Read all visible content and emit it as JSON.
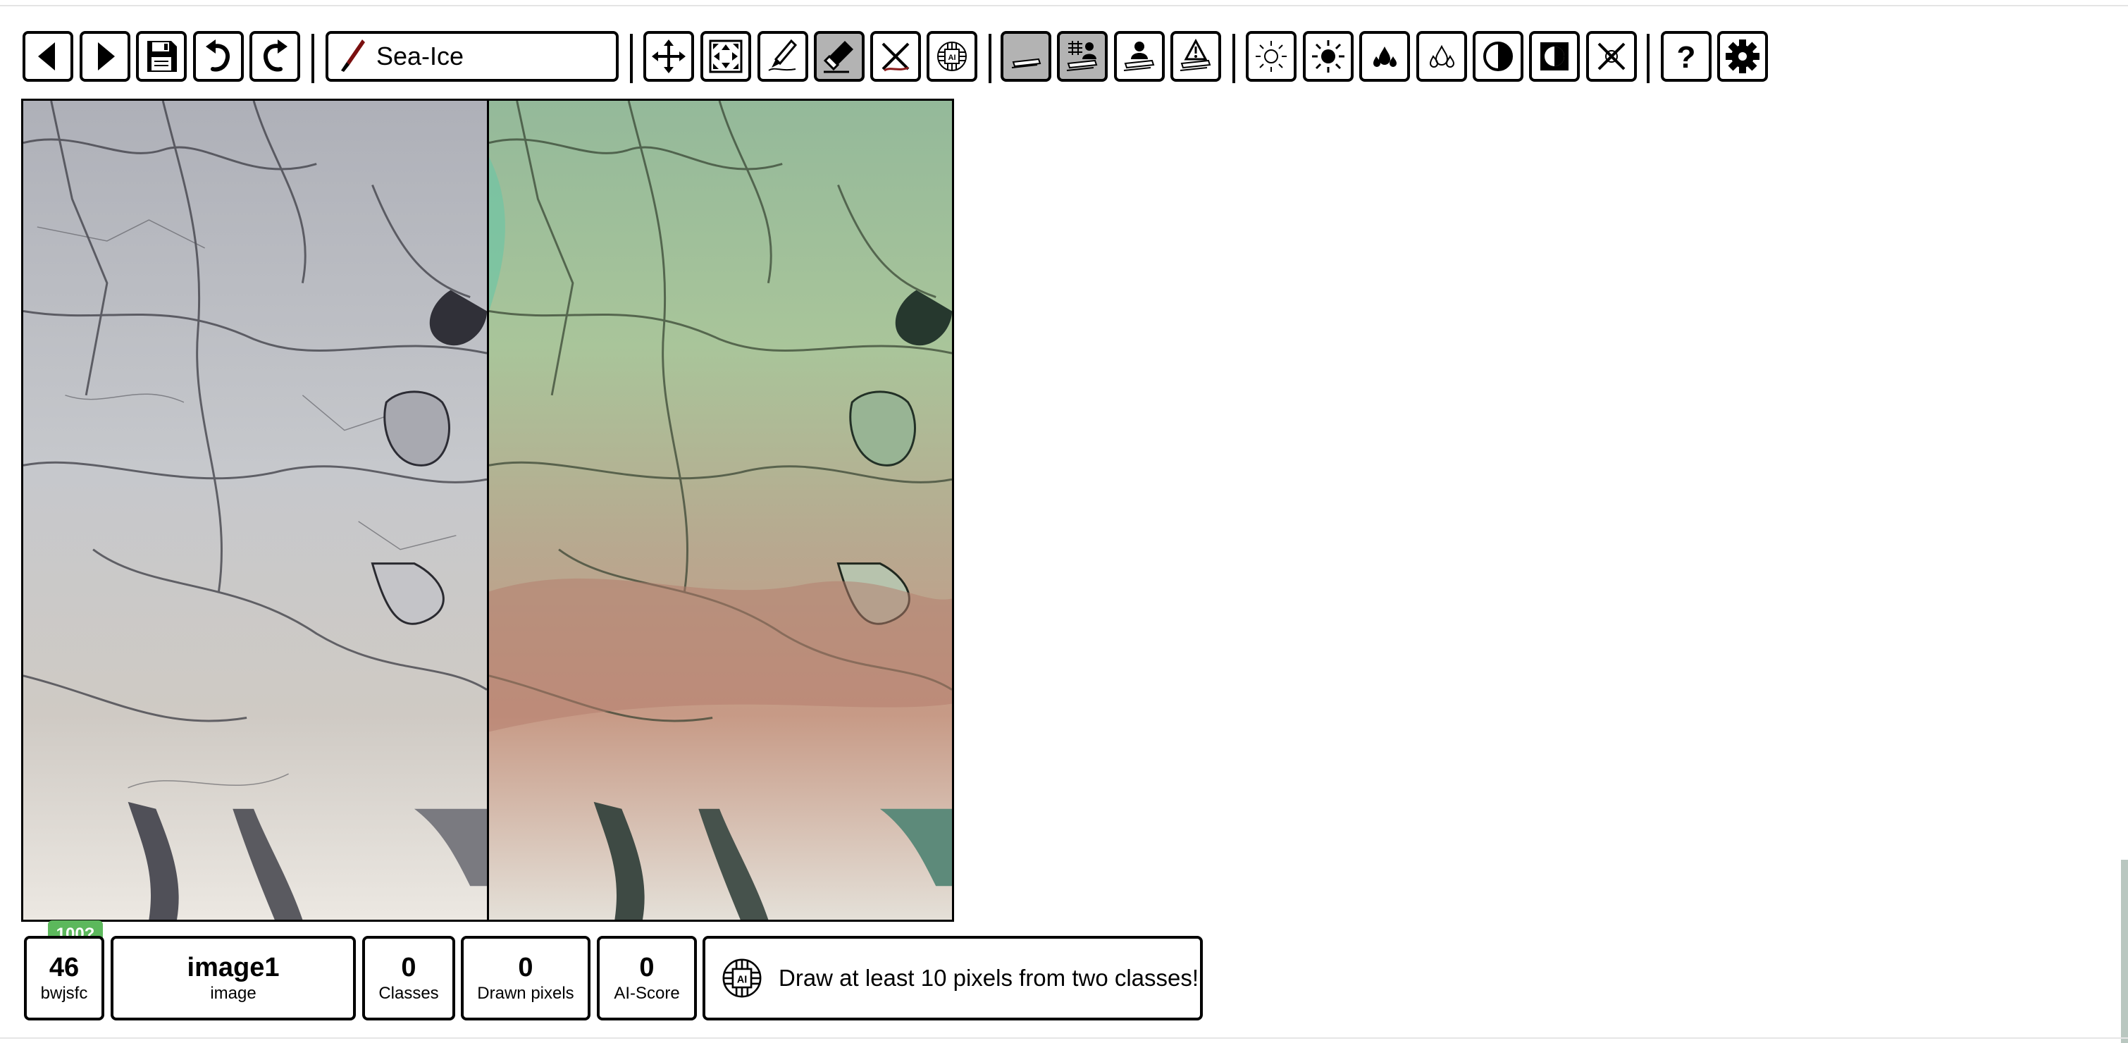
{
  "toolbar": {
    "class_name": "Sea-Ice",
    "buttons": [
      {
        "icon": "previous-icon"
      },
      {
        "icon": "next-icon"
      },
      {
        "icon": "save-icon"
      },
      {
        "icon": "undo-icon"
      },
      {
        "icon": "redo-icon"
      },
      {
        "icon": "move-icon"
      },
      {
        "icon": "fit-screen-icon"
      },
      {
        "icon": "draw-pen-icon"
      },
      {
        "icon": "eraser-icon",
        "active": true
      },
      {
        "icon": "clear-icon"
      },
      {
        "icon": "ai-chip-icon"
      },
      {
        "icon": "layer-image-icon",
        "active": true
      },
      {
        "icon": "layer-annotation-icon",
        "active": true
      },
      {
        "icon": "layer-user-icon"
      },
      {
        "icon": "layer-warning-icon"
      },
      {
        "icon": "brightness-down-icon"
      },
      {
        "icon": "brightness-up-icon"
      },
      {
        "icon": "saturation-up-icon"
      },
      {
        "icon": "saturation-down-icon"
      },
      {
        "icon": "contrast-icon"
      },
      {
        "icon": "contrast-alt-icon"
      },
      {
        "icon": "reset-adjustments-icon"
      },
      {
        "icon": "help-icon"
      },
      {
        "icon": "settings-icon"
      }
    ]
  },
  "images": {
    "left": {
      "description_colors": [
        "#c6c8cc",
        "#e7e3dc"
      ]
    },
    "right": {
      "description_colors": [
        "#a8c69a",
        "#d8c4b0"
      ]
    }
  },
  "info": {
    "badge": "100?",
    "counter": {
      "value": "46",
      "label": "bwjsfc"
    },
    "image": {
      "value": "image1",
      "label": "image"
    },
    "classes": {
      "value": "0",
      "label": "Classes"
    },
    "drawn": {
      "value": "0",
      "label": "Drawn pixels"
    },
    "ai_score": {
      "value": "0",
      "label": "AI-Score"
    },
    "message": "Draw at least 10 pixels from two classes!"
  }
}
